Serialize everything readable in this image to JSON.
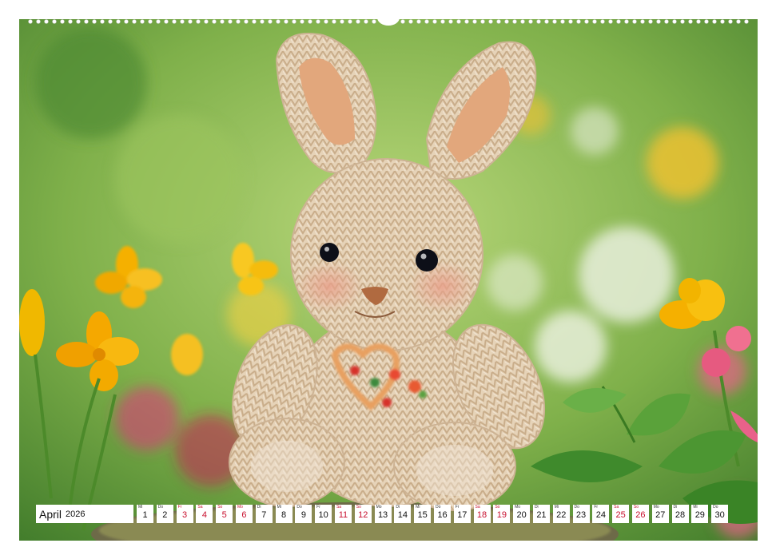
{
  "calendar": {
    "month": "April",
    "year": "2026",
    "days": [
      {
        "wd": "Mi",
        "num": "1",
        "red": false
      },
      {
        "wd": "Do",
        "num": "2",
        "red": false
      },
      {
        "wd": "Fr",
        "num": "3",
        "red": true
      },
      {
        "wd": "Sa",
        "num": "4",
        "red": true
      },
      {
        "wd": "So",
        "num": "5",
        "red": true
      },
      {
        "wd": "Mo",
        "num": "6",
        "red": true
      },
      {
        "wd": "Di",
        "num": "7",
        "red": false
      },
      {
        "wd": "Mi",
        "num": "8",
        "red": false
      },
      {
        "wd": "Do",
        "num": "9",
        "red": false
      },
      {
        "wd": "Fr",
        "num": "10",
        "red": false
      },
      {
        "wd": "Sa",
        "num": "11",
        "red": true
      },
      {
        "wd": "So",
        "num": "12",
        "red": true
      },
      {
        "wd": "Mo",
        "num": "13",
        "red": false
      },
      {
        "wd": "Di",
        "num": "14",
        "red": false
      },
      {
        "wd": "Mi",
        "num": "15",
        "red": false
      },
      {
        "wd": "Do",
        "num": "16",
        "red": false
      },
      {
        "wd": "Fr",
        "num": "17",
        "red": false
      },
      {
        "wd": "Sa",
        "num": "18",
        "red": true
      },
      {
        "wd": "So",
        "num": "19",
        "red": true
      },
      {
        "wd": "Mo",
        "num": "20",
        "red": false
      },
      {
        "wd": "Di",
        "num": "21",
        "red": false
      },
      {
        "wd": "Mi",
        "num": "22",
        "red": false
      },
      {
        "wd": "Do",
        "num": "23",
        "red": false
      },
      {
        "wd": "Fr",
        "num": "24",
        "red": false
      },
      {
        "wd": "Sa",
        "num": "25",
        "red": true
      },
      {
        "wd": "So",
        "num": "26",
        "red": true
      },
      {
        "wd": "Mo",
        "num": "27",
        "red": false
      },
      {
        "wd": "Di",
        "num": "28",
        "red": false
      },
      {
        "wd": "Mi",
        "num": "29",
        "red": false
      },
      {
        "wd": "Do",
        "num": "30",
        "red": false
      }
    ]
  },
  "colors": {
    "weekend_red": "#c8102e",
    "foliage_green": "#6aa84f",
    "flower_yellow": "#f5b800",
    "bunny_yarn": "#e8d6bf"
  }
}
